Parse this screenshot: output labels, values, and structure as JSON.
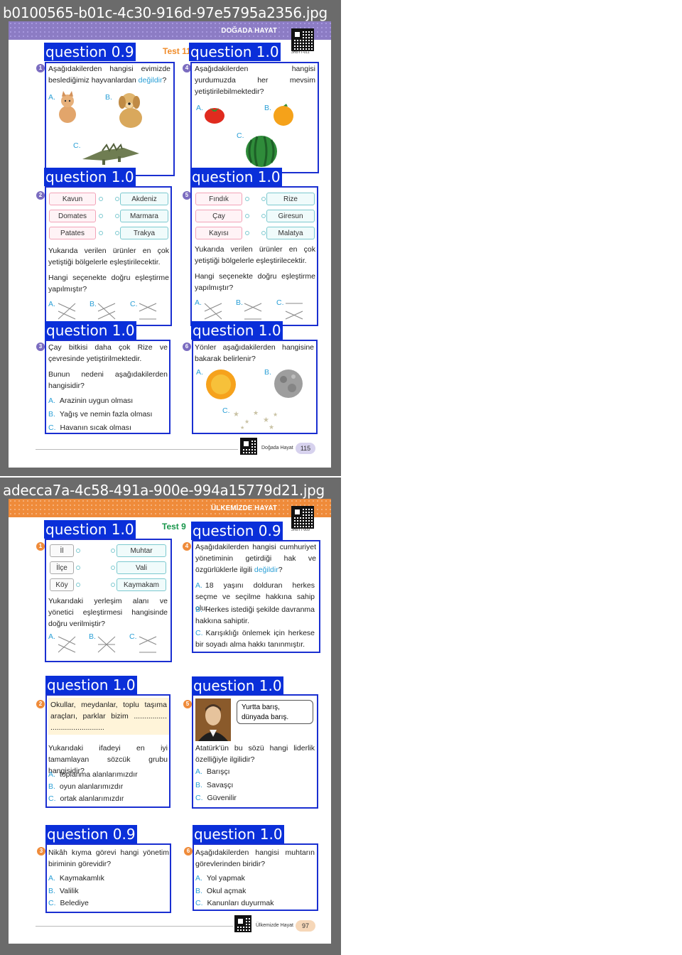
{
  "files": [
    {
      "name": "b0100565-b01c-4c30-916d-97e5795a2356.jpg"
    },
    {
      "name": "adecca7a-4c58-491a-900e-994a15779d21.jpg"
    }
  ],
  "page1": {
    "banner_title": "DOĞADA HAYAT",
    "qr_code_text": "3HBYT-011",
    "test_label": "Test 11",
    "footer": "Doğada Hayat",
    "page_number": "115",
    "colors": {
      "banner": "#8c7cc4",
      "number_badge": "#7b6cc0"
    },
    "questions": [
      {
        "num": "1",
        "score_label": "question 0.9",
        "text_a": "Aşağıdakilerden hangisi evimizde beslediğimiz hayvanlardan ",
        "text_em": "değildir",
        "text_b": "?",
        "options": [
          "A.",
          "B.",
          "C."
        ],
        "icons": [
          "cat-icon",
          "dog-icon",
          "crocodile-icon"
        ]
      },
      {
        "num": "4",
        "score_label": "question 1.0",
        "text": "Aşağıdakilerden hangisi yurdumuzda her mevsim yetiştirilebilmektedir?",
        "options": [
          "A.",
          "B.",
          "C."
        ],
        "icons": [
          "tomato-icon",
          "orange-icon",
          "watermelon-icon"
        ]
      },
      {
        "num": "2",
        "score_label": "question 1.0",
        "left": [
          "Kavun",
          "Domates",
          "Patates"
        ],
        "right": [
          "Akdeniz",
          "Marmara",
          "Trakya"
        ],
        "text1": "Yukarıda verilen ürünler en çok yetiştiği bölgelerle eşleştirilecektir.",
        "text2": "Hangi seçenekte doğru eşleştirme yapılmıştır?",
        "options": [
          "A.",
          "B.",
          "C."
        ]
      },
      {
        "num": "5",
        "score_label": "question 1.0",
        "left": [
          "Fındık",
          "Çay",
          "Kayısı"
        ],
        "right": [
          "Rize",
          "Giresun",
          "Malatya"
        ],
        "text1": "Yukarıda verilen ürünler en çok yetiştiği bölgelerle eşleştirilecektir.",
        "text2": "Hangi seçenekte doğru eşleştirme yapılmıştır?",
        "options": [
          "A.",
          "B.",
          "C."
        ]
      },
      {
        "num": "3",
        "score_label": "question 1.0",
        "text1": "Çay bitkisi daha çok Rize ve çevresinde yetiştirilmektedir.",
        "text2": "Bunun nedeni aşağıdakilerden hangisidir?",
        "options": [
          {
            "letter": "A.",
            "text": "Arazinin uygun olması"
          },
          {
            "letter": "B.",
            "text": "Yağış ve nemin fazla olması"
          },
          {
            "letter": "C.",
            "text": "Havanın sıcak olması"
          }
        ]
      },
      {
        "num": "6",
        "score_label": "question 1.0",
        "text": "Yönler aşağıdakilerden hangisine bakarak belirlenir?",
        "options": [
          "A.",
          "B.",
          "C."
        ],
        "icons": [
          "sun-icon",
          "moon-icon",
          "stars-icon"
        ]
      }
    ]
  },
  "page2": {
    "banner_title": "ÜLKEMİZDE HAYAT",
    "qr_code_text": "3HBYT-009",
    "test_label": "Test 9",
    "footer": "Ülkemizde Hayat",
    "page_number": "97",
    "colors": {
      "banner": "#ef8b3a",
      "number_badge": "#ef8b3a"
    },
    "questions": [
      {
        "num": "1",
        "score_label": "question 1.0",
        "left": [
          "İl",
          "İlçe",
          "Köy"
        ],
        "right": [
          "Muhtar",
          "Vali",
          "Kaymakam"
        ],
        "text": "Yukarıdaki yerleşim alanı ve yönetici eşleştirmesi hangisinde doğru verilmiştir?",
        "options": [
          "A.",
          "B.",
          "C."
        ]
      },
      {
        "num": "4",
        "score_label": "question 0.9",
        "text_a": "Aşağıdakilerden hangisi cumhuriyet yönetiminin getirdiği hak ve özgürlüklerle ilgili ",
        "text_em": "değildir",
        "text_b": "?",
        "options": [
          {
            "letter": "A.",
            "text": "18 yaşını dolduran herkes seçme ve seçilme hakkına sahip olur."
          },
          {
            "letter": "B.",
            "text": "Herkes istediği şekilde davranma hakkına sahiptir."
          },
          {
            "letter": "C.",
            "text": "Karışıklığı önlemek için herkese bir soyadı alma hakkı tanınmıştır."
          }
        ]
      },
      {
        "num": "2",
        "score_label": "question 1.0",
        "quote": "Okullar, meydanlar, toplu taşıma araçları, parklar bizim ................ ..........................",
        "text": "Yukarıdaki ifadeyi en iyi tamamlayan sözcük grubu hangisidir?",
        "options": [
          {
            "letter": "A.",
            "text": "toplanma alanlarımızdır"
          },
          {
            "letter": "B.",
            "text": "oyun alanlarımızdır"
          },
          {
            "letter": "C.",
            "text": "ortak alanlarımızdır"
          }
        ]
      },
      {
        "num": "5",
        "score_label": "question 1.0",
        "speech": "Yurtta barış, dünyada barış.",
        "text": "Atatürk'ün bu sözü hangi liderlik özelliğiyle ilgilidir?",
        "options": [
          {
            "letter": "A.",
            "text": "Barışçı"
          },
          {
            "letter": "B.",
            "text": "Savaşçı"
          },
          {
            "letter": "C.",
            "text": "Güvenilir"
          }
        ]
      },
      {
        "num": "3",
        "score_label": "question 0.9",
        "text": "Nikâh kıyma görevi hangi yönetim biriminin görevidir?",
        "options": [
          {
            "letter": "A.",
            "text": "Kaymakamlık"
          },
          {
            "letter": "B.",
            "text": "Valilik"
          },
          {
            "letter": "C.",
            "text": "Belediye"
          }
        ]
      },
      {
        "num": "6",
        "score_label": "question 1.0",
        "text": "Aşağıdakilerden hangisi muhtarın görevlerinden biridir?",
        "options": [
          {
            "letter": "A.",
            "text": "Yol yapmak"
          },
          {
            "letter": "B.",
            "text": "Okul açmak"
          },
          {
            "letter": "C.",
            "text": "Kanunları duyurmak"
          }
        ]
      }
    ]
  }
}
